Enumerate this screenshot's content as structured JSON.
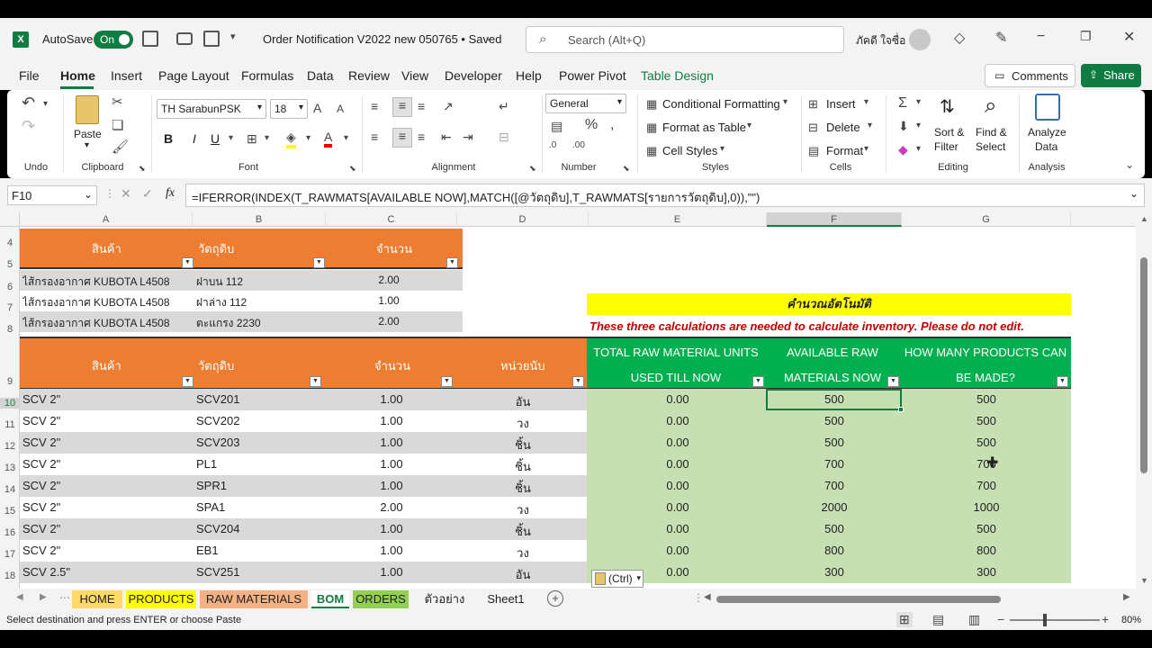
{
  "titlebar": {
    "autosave_label": "AutoSave",
    "toggle": "On",
    "title": "Order Notification V2022 new 050765 • Saved",
    "search": "Search (Alt+Q)",
    "user": "ภัคดี ใจซื่อ"
  },
  "menu": [
    "File",
    "Home",
    "Insert",
    "Page Layout",
    "Formulas",
    "Data",
    "Review",
    "View",
    "Developer",
    "Help",
    "Power Pivot",
    "Table Design"
  ],
  "menu_right": {
    "comments": "Comments",
    "share": "Share"
  },
  "ribbon": {
    "undo_label": "Undo",
    "clipboard_label": "Clipboard",
    "paste": "Paste",
    "font_name": "TH SarabunPSK",
    "font_size": "18",
    "font_label": "Font",
    "alignment_label": "Alignment",
    "number_format": "General",
    "number_label": "Number",
    "cond_format": "Conditional Formatting",
    "format_table": "Format as Table",
    "cell_styles": "Cell Styles",
    "styles_label": "Styles",
    "insert": "Insert",
    "delete": "Delete",
    "format": "Format",
    "cells_label": "Cells",
    "sort_filter": "Sort &",
    "sort_filter2": "Filter",
    "find_select": "Find &",
    "find_select2": "Select",
    "editing_label": "Editing",
    "analyze": "Analyze",
    "analyze2": "Data",
    "analysis_label": "Analysis",
    "bold": "B",
    "italic": "I",
    "underline": "U"
  },
  "formula": {
    "namebox": "F10",
    "fx": "fx",
    "text": "=IFERROR(INDEX(T_RAWMATS[AVAILABLE NOW],MATCH([@วัตถุดิบ],T_RAWMATS[รายการวัตถุดิบ],0)),\"\")"
  },
  "columns": [
    "A",
    "B",
    "C",
    "D",
    "E",
    "F",
    "G"
  ],
  "rows": [
    "4",
    "5",
    "6",
    "7",
    "8",
    "9",
    "10",
    "11",
    "12",
    "13",
    "14",
    "15",
    "16",
    "17",
    "18"
  ],
  "table1": {
    "headers": [
      "สินค้า",
      "วัตถุดิบ",
      "จำนวน"
    ],
    "rows": [
      [
        "ไส้กรองอากาศ KUBOTA L4508",
        "ฝาบน 112",
        "2.00"
      ],
      [
        "ไส้กรองอากาศ KUBOTA L4508",
        "ฝาล่าง 112",
        "1.00"
      ],
      [
        "ไส้กรองอากาศ KUBOTA L4508",
        "ตะแกรง 2230",
        "2.00"
      ]
    ]
  },
  "calc_banner": "คำนวณอัตโนมัติ",
  "calc_note": "These three calculations are needed to calculate inventory. Please do not edit.",
  "table2": {
    "headers": [
      "สินค้า",
      "วัตถุดิบ",
      "จำนวน",
      "หน่วยนับ"
    ],
    "green_headers": [
      [
        "TOTAL RAW MATERIAL UNITS",
        "USED TILL NOW"
      ],
      [
        "AVAILABLE RAW",
        "MATERIALS NOW"
      ],
      [
        "HOW MANY PRODUCTS CAN",
        "BE MADE?"
      ]
    ],
    "rows": [
      [
        "SCV 2\"",
        "SCV201",
        "1.00",
        "อัน",
        "0.00",
        "500",
        "500"
      ],
      [
        "SCV 2\"",
        "SCV202",
        "1.00",
        "วง",
        "0.00",
        "500",
        "500"
      ],
      [
        "SCV 2\"",
        "SCV203",
        "1.00",
        "ชิ้น",
        "0.00",
        "500",
        "500"
      ],
      [
        "SCV 2\"",
        "PL1",
        "1.00",
        "ชิ้น",
        "0.00",
        "700",
        "700"
      ],
      [
        "SCV 2\"",
        "SPR1",
        "1.00",
        "ชิ้น",
        "0.00",
        "700",
        "700"
      ],
      [
        "SCV 2\"",
        "SPA1",
        "2.00",
        "วง",
        "0.00",
        "2000",
        "1000"
      ],
      [
        "SCV 2\"",
        "SCV204",
        "1.00",
        "ชิ้น",
        "0.00",
        "500",
        "500"
      ],
      [
        "SCV 2\"",
        "EB1",
        "1.00",
        "วง",
        "0.00",
        "800",
        "800"
      ],
      [
        "SCV 2.5\"",
        "SCV251",
        "1.00",
        "อัน",
        "0.00",
        "300",
        "300"
      ]
    ]
  },
  "paste_ctrl": "(Ctrl)",
  "sheet_tabs": [
    {
      "label": "HOME",
      "color": "#ffd966"
    },
    {
      "label": "PRODUCTS",
      "color": "#ffff00"
    },
    {
      "label": "RAW MATERIALS",
      "color": "#f4b183"
    },
    {
      "label": "BOM",
      "color": "#ffffff"
    },
    {
      "label": "ORDERS",
      "color": "#92d050"
    },
    {
      "label": "ตัวอย่าง",
      "color": "#f3f3f3"
    },
    {
      "label": "Sheet1",
      "color": "#f3f3f3"
    }
  ],
  "status": {
    "message": "Select destination and press ENTER or choose Paste",
    "zoom": "80%"
  },
  "colors": {
    "orange": "#ed7d31",
    "green_hdr": "#00b050",
    "green_body": "#c6e0b4",
    "yellow": "#ffff00",
    "gray_row": "#d9d9d9",
    "excel_green": "#107c41"
  }
}
